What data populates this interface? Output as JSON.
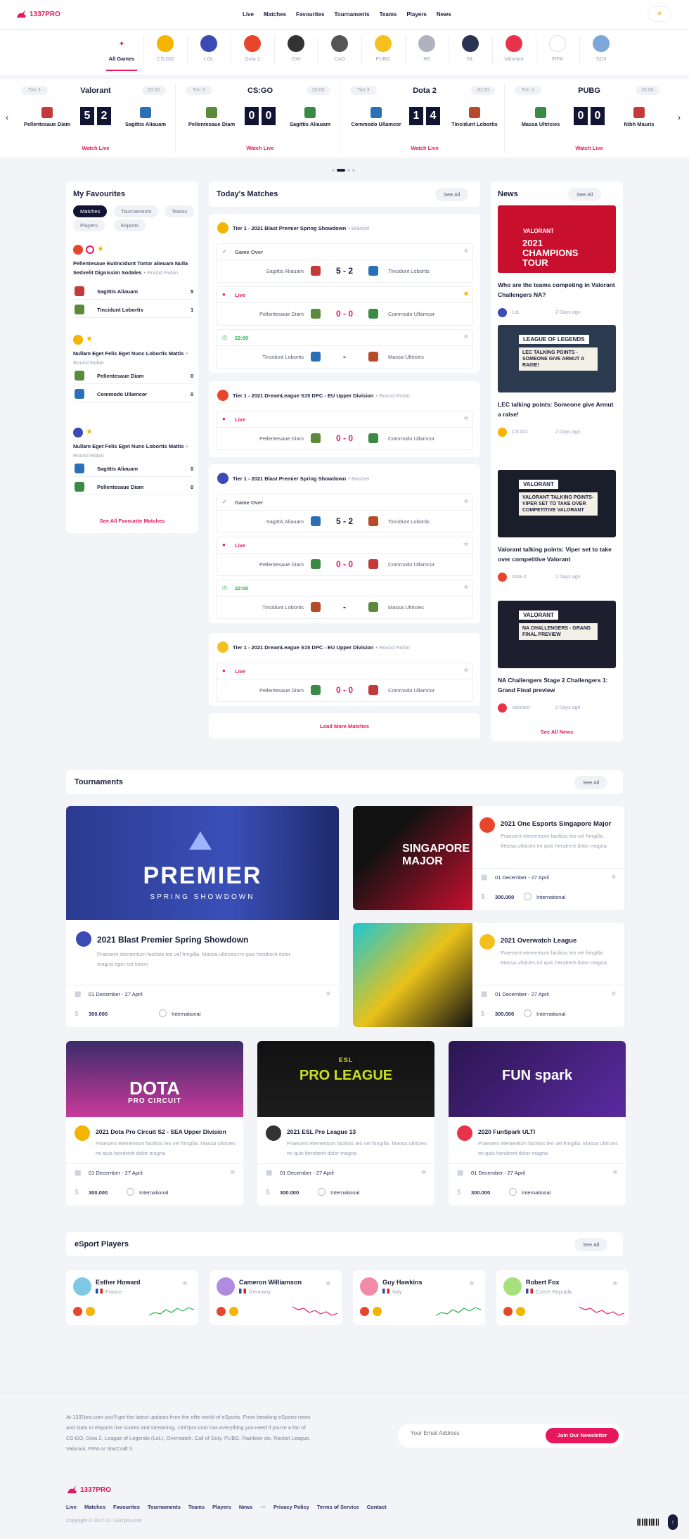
{
  "brand": {
    "logo": "1337PRO",
    "accent": "#e8175d"
  },
  "nav": [
    "Live",
    "Matches",
    "Favourites",
    "Tournaments",
    "Teams",
    "Players",
    "News"
  ],
  "games": [
    {
      "label": "All Games",
      "color": "#e8175d",
      "icon": "rabbit-icon"
    },
    {
      "label": "CS:GO",
      "color": "#f5b400",
      "icon": "csgo-icon"
    },
    {
      "label": "LOL",
      "color": "#3c4bb4",
      "icon": "lol-icon"
    },
    {
      "label": "Dota 2",
      "color": "#e8452d",
      "icon": "dota-icon"
    },
    {
      "label": "OW",
      "color": "#333333",
      "icon": "overwatch-icon"
    },
    {
      "label": "CoD",
      "color": "#555555",
      "icon": "cod-icon"
    },
    {
      "label": "PUBG",
      "color": "#f4c020",
      "icon": "pubg-icon"
    },
    {
      "label": "R6",
      "color": "#b0b3bf",
      "icon": "r6-icon"
    },
    {
      "label": "RL",
      "color": "#2a3450",
      "icon": "rl-icon"
    },
    {
      "label": "Valorant",
      "color": "#e8324a",
      "icon": "valorant-icon"
    },
    {
      "label": "FIFA",
      "color": "#ffffff",
      "icon": "fifa-icon"
    },
    {
      "label": "SCII",
      "color": "#7ea6d8",
      "icon": "sc2-icon"
    }
  ],
  "live": [
    {
      "tier": "Tier 3",
      "game": "Valorant",
      "time": "20:00",
      "t1": "Pellentesaue Diam",
      "t2": "Sagittis Aliauam",
      "s1": "5",
      "s2": "2",
      "watch": "Watch Live"
    },
    {
      "tier": "Tier 3",
      "game": "CS:GO",
      "time": "20:00",
      "t1": "Pellentesaue Diam",
      "t2": "Sagittis Aliauam",
      "s1": "0",
      "s2": "0",
      "watch": "Watch Live"
    },
    {
      "tier": "Tier 3",
      "game": "Dota 2",
      "time": "20:00",
      "t1": "Commodo Ullamcor",
      "t2": "Tincidunt Lobortis",
      "s1": "1",
      "s2": "4",
      "watch": "Watch Live"
    },
    {
      "tier": "Tier 3",
      "game": "PUBG",
      "time": "20:00",
      "t1": "Massa Ultricies",
      "t2": "Nibh Mauris",
      "s1": "0",
      "s2": "0",
      "watch": "Watch Live"
    }
  ],
  "fav": {
    "title": "My Favourites",
    "tabs": [
      "Matches",
      "Tournaments",
      "Teams",
      "Players",
      "Esports"
    ],
    "groups": [
      {
        "title": "Pellentesaue Eutincidunt Tortor alieuam Nulla Sedvelit Dignissim Sodales",
        "sub": "• Round Robin",
        "rows": [
          [
            "Sagittis Aliauam",
            "5"
          ],
          [
            "Tincidunt Lobortis",
            "1"
          ]
        ]
      },
      {
        "title": "Nullam Eget Felis Eget Nunc Lobortis Mattis",
        "sub": "• Round Robin",
        "rows": [
          [
            "Pellentesaue Diam",
            "0"
          ],
          [
            "Commodo Ullamcor",
            "0"
          ]
        ]
      },
      {
        "title": "Nullam Eget Felis Eget Nunc Lobortis Mattis",
        "sub": "• Round Robin",
        "rows": [
          [
            "Sagittis Aliauam",
            "0"
          ],
          [
            "Pellentesaue Diam",
            "0"
          ]
        ]
      }
    ],
    "see_all": "See All Favourite Matches"
  },
  "today": {
    "title": "Today's Matches",
    "see_all": "See All",
    "blocks": [
      {
        "tier": "Tier 1 - 2021 Blast Premier Spring Showdown",
        "stage": "• Bracket",
        "matches": [
          {
            "status": "Game Over",
            "t1": "Sagittis Aliauam",
            "score": "5 - 2",
            "t2": "Tincidunt Lobortis"
          },
          {
            "status": "Live",
            "t1": "Pellentesaue Diam",
            "score": "0 - 0",
            "t2": "Commodo Ullamcor"
          },
          {
            "status": "22:00",
            "t1": "Tincidunt Lobortis",
            "score": "-",
            "t2": "Massa Ultricies"
          }
        ]
      },
      {
        "tier": "Tier 1 - 2021 DreamLeague S15 DPC - EU Upper Division",
        "stage": "• Round Robin",
        "matches": [
          {
            "status": "Live",
            "t1": "Pellentesaue Diam",
            "score": "0 - 0",
            "t2": "Commodo Ullamcor"
          }
        ]
      },
      {
        "tier": "Tier 1 - 2021 Blast Premier Spring Showdown",
        "stage": "• Bracket",
        "matches": [
          {
            "status": "Game Over",
            "t1": "Sagittis Aliauam",
            "score": "5 - 2",
            "t2": "Tincidunt Lobortis"
          },
          {
            "status": "Live",
            "t1": "Pellentesaue Diam",
            "score": "0 - 0",
            "t2": "Commodo Ullamcor"
          },
          {
            "status": "22:00",
            "t1": "Tincidunt Lobortis",
            "score": "-",
            "t2": "Massa Ultricies"
          }
        ]
      },
      {
        "tier": "Tier 1 - 2021 DreamLeague S15 DPC - EU Upper Division",
        "stage": "• Round Robin",
        "matches": [
          {
            "status": "Live",
            "t1": "Pellentesaue Diam",
            "score": "0 - 0",
            "t2": "Commodo Ullamcor"
          }
        ]
      }
    ],
    "load_more": "Load More Matches"
  },
  "news": {
    "title": "News",
    "see_all": "See All",
    "items": [
      {
        "img_title": "2021 CHAMPIONS TOUR",
        "img_sub": "VALORANT",
        "title": "Who are the teams competing in Valorant Challengers NA?",
        "game": "LoL",
        "ago": "2 Days ago"
      },
      {
        "img_title": "LEC TALKING POINTS - SOMEONE GIVE ARMUT A RAISE!",
        "img_sub": "LEAGUE OF LEGENDS",
        "title": "LEC talking points: Someone give Armut a raise!",
        "game": "CS:GO",
        "ago": "2 Days ago"
      },
      {
        "img_title": "VALORANT TALKING POINTS- VIPER SET TO TAKE OVER COMPETITIVE VALORANT",
        "img_sub": "VALORANT",
        "title": "Valorant talking points: Viper set to take over competitive Valorant",
        "game": "Dota 2",
        "ago": "2 Days ago"
      },
      {
        "img_title": "NA CHALLENGERS - GRAND FINAL PREVIEW",
        "img_sub": "VALORANT",
        "title": "NA Challengers Stage 2 Challengers 1: Grand Final preview",
        "game": "Valorant",
        "ago": "2 Days ago"
      }
    ],
    "see_all_bottom": "See All News"
  },
  "tournaments": {
    "title": "Tournaments",
    "see_all": "See All",
    "big": {
      "banner": "PREMIER",
      "banner_sub": "SPRING SHOWDOWN",
      "title": "2021 Blast Premier Spring Showdown",
      "desc": "Praesent elementum facilisis leo vel fringilla. Massa ultricies mi quis hendrerit dolor magna eget est lorem",
      "dates": "01 December - 27 April",
      "prize": "300.000",
      "region": "International"
    },
    "side": [
      {
        "banner": "SINGAPORE MAJOR",
        "title": "2021 One Esports Singapore Major",
        "desc": "Praesent elementum facilisis leo vel fringilla. Massa ultricies mi quis hendrerit dolor magna",
        "dates": "01 December - 27 April",
        "prize": "300.000",
        "region": "International"
      },
      {
        "banner": "",
        "title": "2021 Overwatch League",
        "desc": "Praesent elementum facilisis leo vel fringilla. Massa ultricies mi quis hendrerit dolor magna",
        "dates": "01 December - 27 April",
        "prize": "300.000",
        "region": "International"
      }
    ],
    "bottom": [
      {
        "banner": "DOTA",
        "banner_sub": "PRO CIRCUIT",
        "title": "2021 Dota Pro Circuit S2 - SEA Upper Division",
        "desc": "Praesent elementum facilisis leo vel fringilla. Massa ultricies mi quis hendrerit dolor magna",
        "dates": "01 December - 27 April",
        "prize": "300.000",
        "region": "International"
      },
      {
        "banner": "PRO LEAGUE",
        "banner_sub": "ESL",
        "title": "2021 ESL Pro League 13",
        "desc": "Praesent elementum facilisis leo vel fringilla. Massa ultricies mi quis hendrerit dolor magna",
        "dates": "01 December - 27 April",
        "prize": "300.000",
        "region": "International"
      },
      {
        "banner": "FUN spark",
        "banner_sub": "",
        "title": "2020 FunSpark ULTI",
        "desc": "Praesent elementum facilisis leo vel fringilla. Massa ultricies mi quis hendrerit dolor magna",
        "dates": "01 December - 27 April",
        "prize": "300.000",
        "region": "International"
      }
    ]
  },
  "players": {
    "title": "eSport Players",
    "see_all": "See All",
    "items": [
      {
        "name": "Esther Howard",
        "country": "France",
        "trend": "up"
      },
      {
        "name": "Cameron Williamson",
        "country": "Germany",
        "trend": "down"
      },
      {
        "name": "Guy Hawkins",
        "country": "Italy",
        "trend": "up"
      },
      {
        "name": "Robert Fox",
        "country": "Czech Republic",
        "trend": "down"
      }
    ]
  },
  "footer": {
    "about": "At 1337pro.com you'll get the latest updates from the elite world of eSports. From breaking eSports news and stats to eSports live scores and streaming, 1337pro.com has everything you need if you're a fan of CS:GO, Dota 2, League of Legends (LoL), Overwatch, Call of Duty, PUBG, Rainbow six, Rocket League, Valorant, FIFA or StarCraft II.",
    "email_placeholder": "Your Email Address",
    "subscribe": "Join Our Newsletter",
    "links": [
      "Live",
      "Matches",
      "Favourites",
      "Tournaments",
      "Teams",
      "Players",
      "News",
      "···",
      "Privacy Policy",
      "Terms of Service",
      "Contact"
    ],
    "copyright": "Copyright © 2017-21 1337pro.com"
  }
}
